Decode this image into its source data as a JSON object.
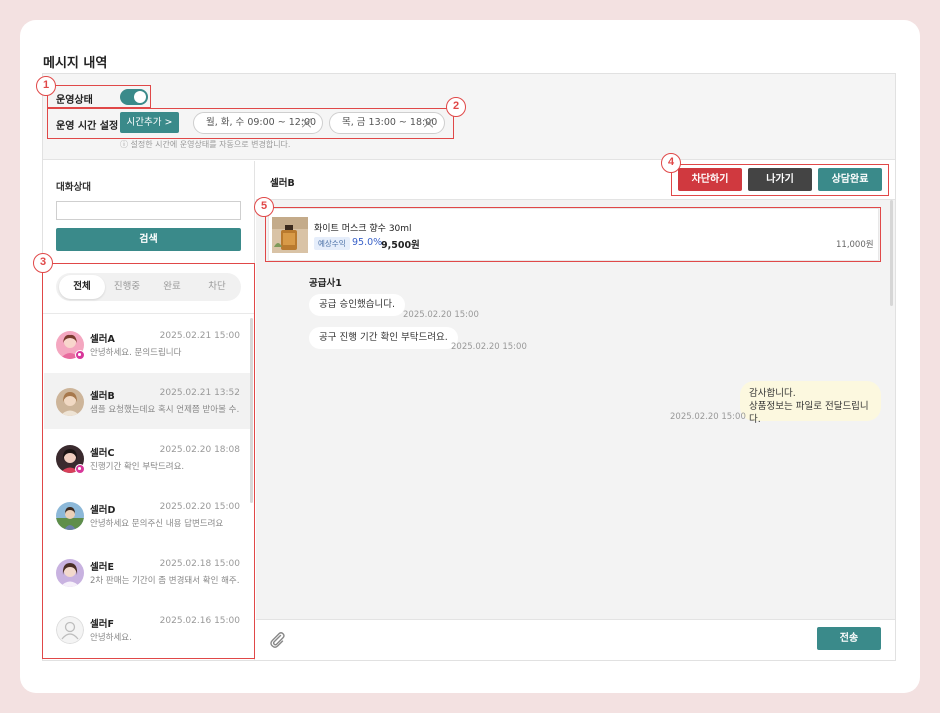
{
  "page": {
    "title": "메시지 내역"
  },
  "settings": {
    "status_label": "운영상태",
    "status_on": true,
    "time_label": "운영 시간 설정",
    "add_time_label": "시간추가 >",
    "time_chips": [
      "월, 화, 수 09:00 ~ 12:00",
      "목, 금 13:00 ~ 18:00"
    ],
    "hint": "ⓘ 설정한 시간에 운영상태를 자동으로 변경합니다."
  },
  "sidebar": {
    "partner_label": "대화상대",
    "search_placeholder": "",
    "search_button": "검색",
    "tabs": [
      "전체",
      "진행중",
      "완료",
      "차단"
    ],
    "conversations": [
      {
        "name": "셀러A",
        "time": "2025.02.21 15:00",
        "message": "안녕하세요. 문의드립니다"
      },
      {
        "name": "셀러B",
        "time": "2025.02.21 13:52",
        "message": "샘플 요청했는데요 혹시 언제쯤 받아볼 수…"
      },
      {
        "name": "셀러C",
        "time": "2025.02.20 18:08",
        "message": "진행기간 확인 부탁드려요."
      },
      {
        "name": "셀러D",
        "time": "2025.02.20 15:00",
        "message": "안녕하세요 문의주신 내용 답변드려요"
      },
      {
        "name": "셀러E",
        "time": "2025.02.18 15:00",
        "message": "2차 판매는 기간이 좀 변경돼서 확인 해주…"
      },
      {
        "name": "셀러F",
        "time": "2025.02.16 15:00",
        "message": "안녕하세요."
      }
    ]
  },
  "chat": {
    "partner_name": "셀러B",
    "buttons": {
      "block": "차단하기",
      "leave": "나가기",
      "complete": "상담완료"
    },
    "product": {
      "name": "화이트 머스크 향수 30ml",
      "tag": "예상수익",
      "percent": "95.0%",
      "price": "9,500원",
      "original_price": "11,000원"
    },
    "sender": "공급사1",
    "messages": [
      {
        "text": "공급 승인했습니다.",
        "time": "2025.02.20 15:00"
      },
      {
        "text": "공구 진행 기간 확인 부탁드려요.",
        "time": "2025.02.20 15:00"
      }
    ],
    "my_message": {
      "line1": "감사합니다.",
      "line2": "상품정보는 파일로 전달드립니다.",
      "time": "2025.02.20 15:00"
    },
    "send_label": "전송"
  },
  "annotations": [
    "1",
    "2",
    "3",
    "4",
    "5"
  ],
  "colors": {
    "accent": "#3a8a8a",
    "block": "#d0393f",
    "leave": "#444444",
    "annotation": "#e04848"
  }
}
